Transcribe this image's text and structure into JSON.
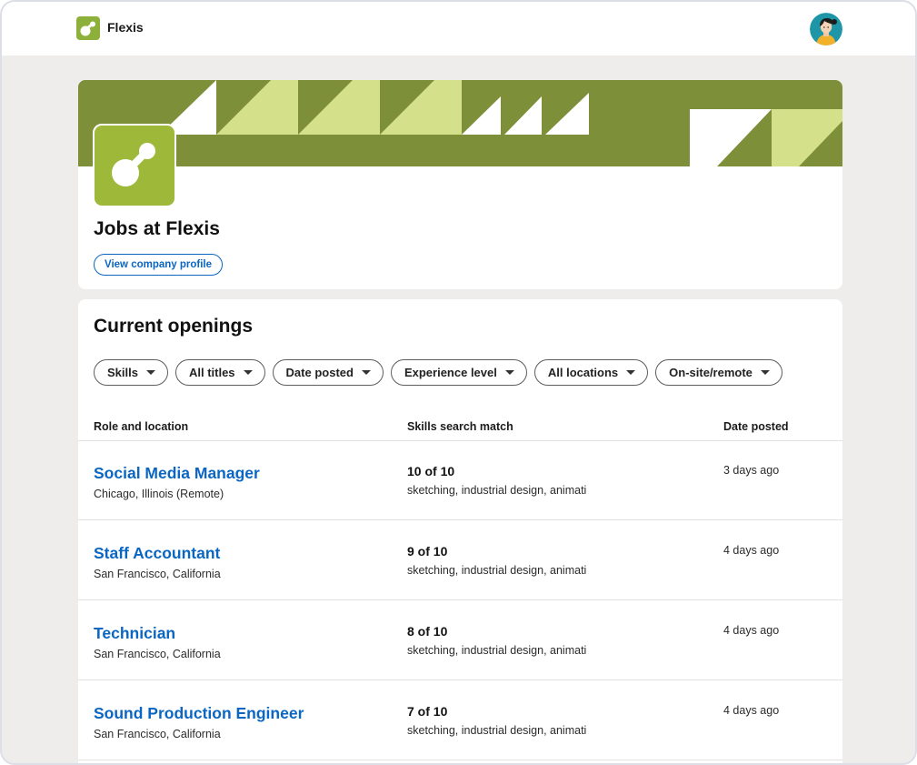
{
  "colors": {
    "brand_green": "#8db03a",
    "banner_dark": "#7e8f3a",
    "banner_light": "#d5e08a",
    "link_blue": "#0a66c2",
    "page_bg": "#efedeb"
  },
  "nav": {
    "brand": "Flexis",
    "logo_icon": "flexis-logo-icon",
    "avatar_icon": "user-avatar"
  },
  "hero": {
    "title": "Jobs at Flexis",
    "profile_button": "View company profile"
  },
  "openings": {
    "title": "Current openings",
    "filters": [
      "Skills",
      "All titles",
      "Date posted",
      "Experience level",
      "All locations",
      "On-site/remote"
    ],
    "columns": {
      "role": "Role and location",
      "skills": "Skills search match",
      "date": "Date posted"
    },
    "rows": [
      {
        "title": "Social Media Manager",
        "location": "Chicago, Illinois (Remote)",
        "match": "10 of 10",
        "skills": "sketching, industrial design, animati",
        "date": "3 days ago"
      },
      {
        "title": "Staff Accountant",
        "location": "San Francisco, California",
        "match": "9 of 10",
        "skills": "sketching, industrial design, animati",
        "date": "4 days ago"
      },
      {
        "title": "Technician",
        "location": "San Francisco, California",
        "match": "8 of 10",
        "skills": "sketching, industrial design, animati",
        "date": "4 days ago"
      },
      {
        "title": "Sound Production Engineer",
        "location": "San Francisco, California",
        "match": "7 of 10",
        "skills": "sketching, industrial design, animati",
        "date": "4 days ago"
      }
    ]
  }
}
